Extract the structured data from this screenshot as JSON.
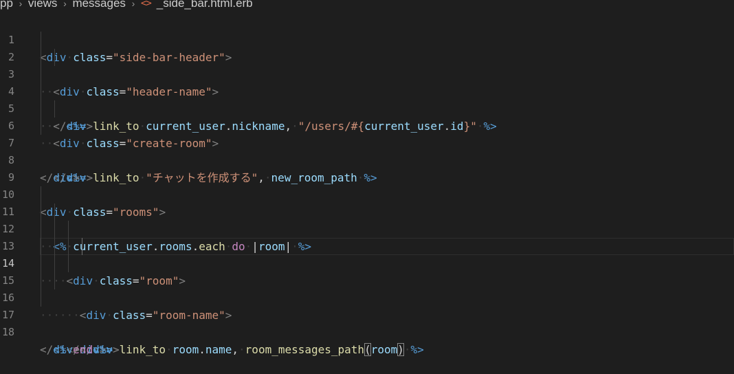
{
  "breadcrumb": {
    "items": [
      "pp",
      "views",
      "messages"
    ],
    "file_icon": "<>",
    "file_name": "_side_bar.html.erb"
  },
  "editor": {
    "line_numbers": [
      "1",
      "2",
      "3",
      "4",
      "5",
      "6",
      "7",
      "8",
      "9",
      "10",
      "11",
      "12",
      "13",
      "14",
      "15",
      "16",
      "17",
      "18"
    ],
    "code": {
      "div": "div",
      "class": "class",
      "side_bar_header": "\"side-bar-header\"",
      "header_name": "\"header-name\"",
      "erb_out_open": "<%=",
      "erb_open": "<%",
      "erb_close": "%>",
      "link_to": "link_to",
      "current_user": "current_user",
      "nickname": "nickname",
      "users_path_start": "\"/users/#{",
      "id": "id",
      "users_path_end": "}\"",
      "create_room": "\"create-room\"",
      "chat_create": "\"チャットを作成する\"",
      "new_room_path": "new_room_path",
      "rooms_str": "\"rooms\"",
      "rooms": "rooms",
      "each": "each",
      "do": "do",
      "room": "room",
      "room_str": "\"room\"",
      "room_name_str": "\"room-name\"",
      "name": "name",
      "room_messages_path": "room_messages_path",
      "end": "end"
    }
  }
}
